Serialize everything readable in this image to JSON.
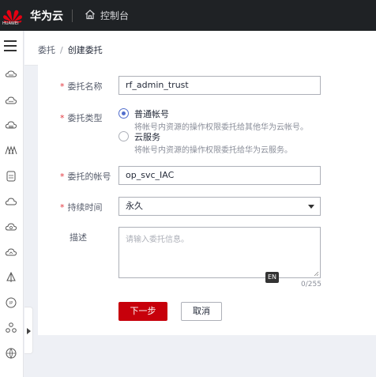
{
  "topbar": {
    "logo_text": "HUAWEI",
    "brand": "华为云",
    "console_label": "控制台"
  },
  "breadcrumb": {
    "parent": "委托",
    "separator": "/",
    "current": "创建委托"
  },
  "form": {
    "name": {
      "label": "委托名称",
      "value": "rf_admin_trust"
    },
    "type": {
      "label": "委托类型",
      "options": [
        {
          "label": "普通帐号",
          "desc": "将帐号内资源的操作权限委托给其他华为云帐号。",
          "checked": true
        },
        {
          "label": "云服务",
          "desc": "将帐号内资源的操作权限委托给华为云服务。",
          "checked": false
        }
      ]
    },
    "account": {
      "label": "委托的帐号",
      "value": "op_svc_IAC"
    },
    "duration": {
      "label": "持续时间",
      "value": "永久"
    },
    "description": {
      "label": "描述",
      "placeholder": "请输入委托信息。",
      "counter": "0/255",
      "ime_badge": "EN"
    },
    "next_button": "下一步",
    "cancel_button": "取消"
  },
  "colors": {
    "topbar_bg": "#1f2225",
    "primary": "#c7000b",
    "radio_accent": "#526ecc",
    "required_star": "#e3383f"
  },
  "icons": [
    "huawei-logo-icon",
    "home-icon",
    "menu-icon",
    "chevron-right-icon"
  ]
}
